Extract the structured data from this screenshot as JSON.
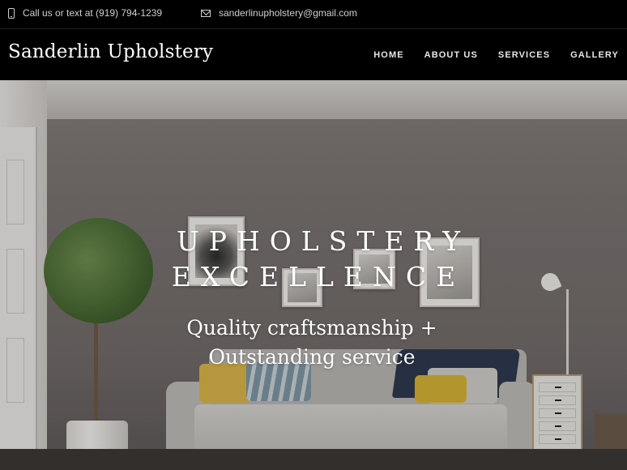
{
  "topbar": {
    "phone_text": "Call us or text at (919) 794-1239",
    "email_text": "sanderlinupholstery@gmail.com",
    "phone_icon": "mobile-phone-icon",
    "email_icon": "envelope-icon"
  },
  "header": {
    "brand": "Sanderlin Upholstery",
    "nav": [
      "HOME",
      "ABOUT US",
      "SERVICES",
      "GALLERY"
    ]
  },
  "hero": {
    "title_line1": "UPHOLSTERY",
    "title_line2": "EXCELLENCE",
    "subtitle": "Quality craftsmanship + Outstanding service"
  },
  "colors": {
    "topbar_bg": "#000000",
    "header_bg": "#000000",
    "text": "#ffffff",
    "wall": "#7a7472"
  }
}
